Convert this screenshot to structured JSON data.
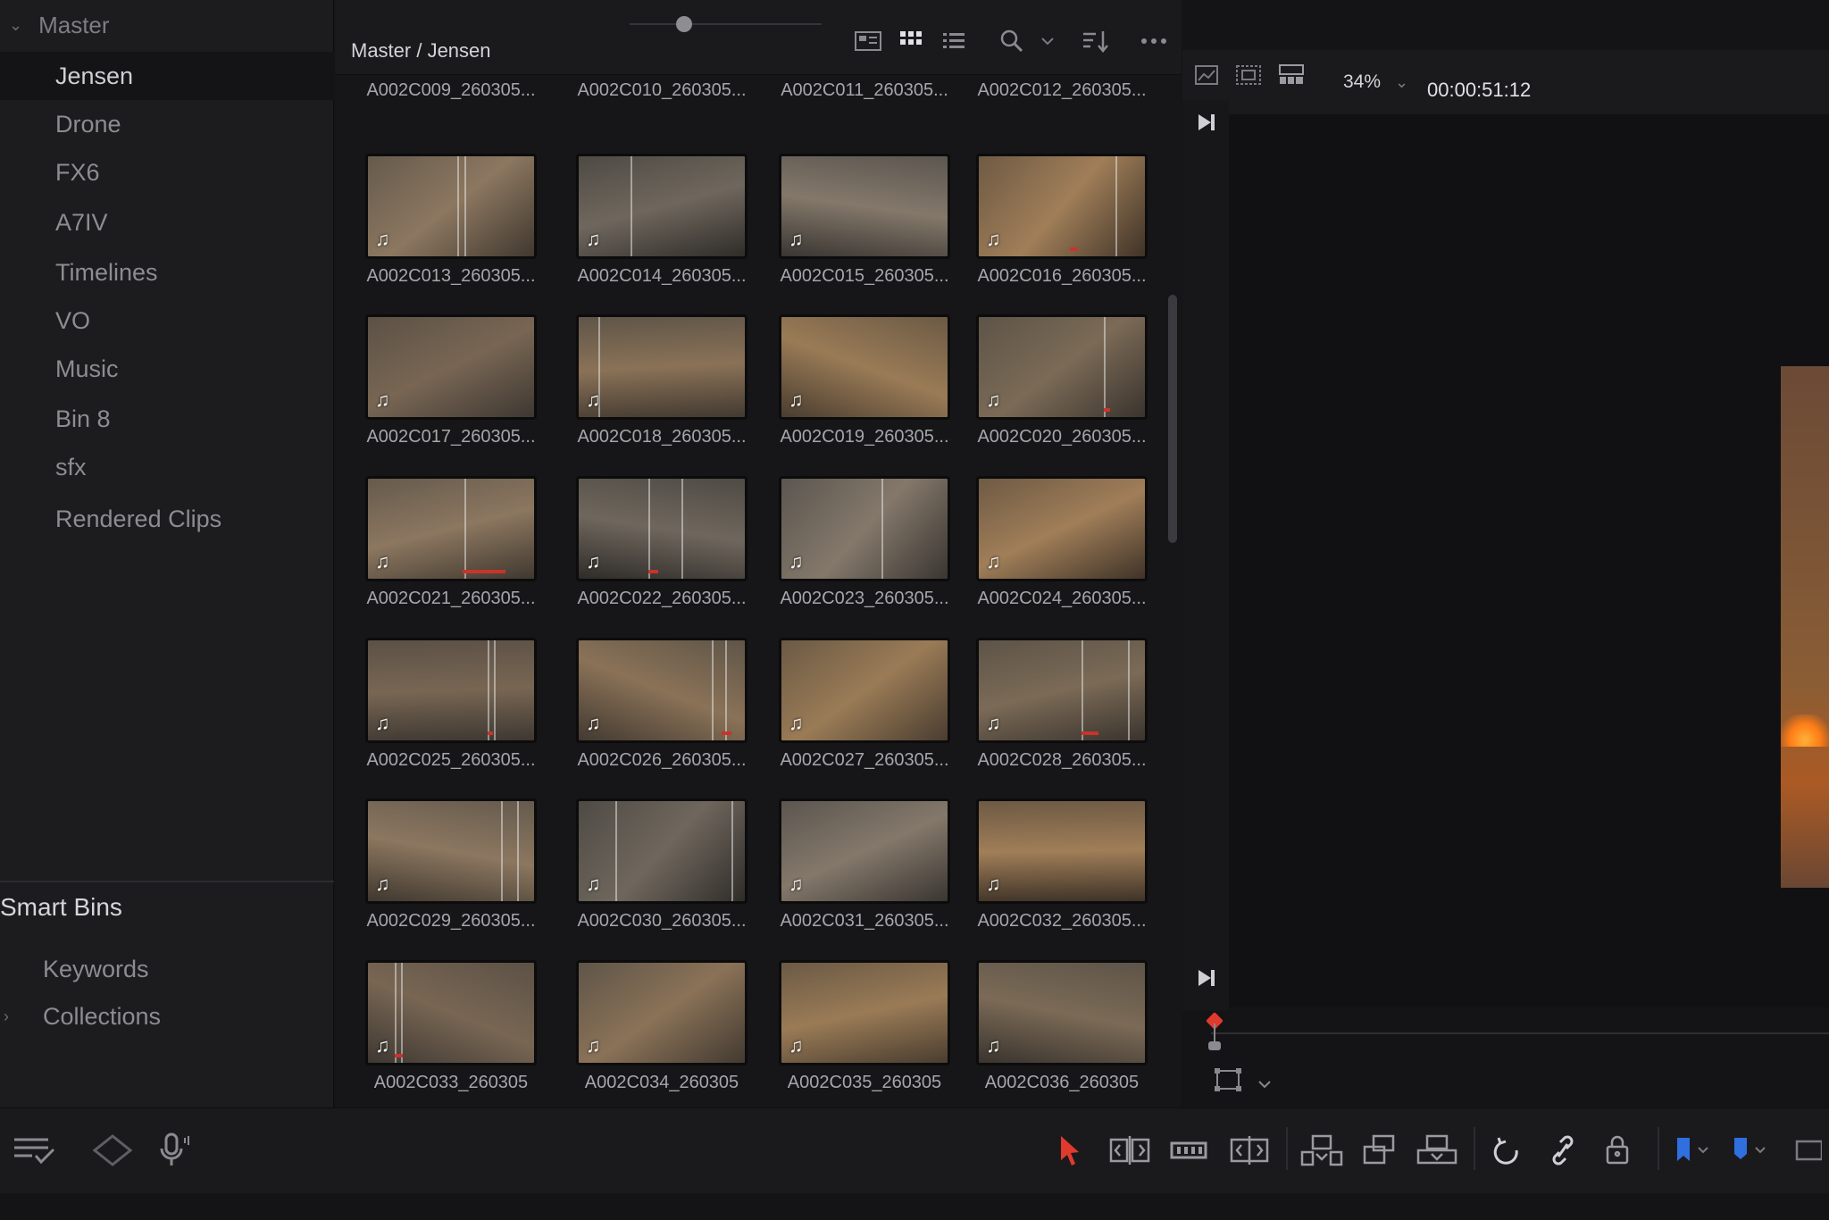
{
  "sidebar": {
    "root_label": "Master",
    "items": [
      {
        "label": "Jensen",
        "active": true
      },
      {
        "label": "Drone"
      },
      {
        "label": "FX6"
      },
      {
        "label": "A7IV"
      },
      {
        "label": "Timelines"
      },
      {
        "label": "VO"
      },
      {
        "label": "Music"
      },
      {
        "label": "Bin 8"
      },
      {
        "label": "sfx"
      },
      {
        "label": "Rendered Clips"
      }
    ],
    "smart_bins_title": "Smart Bins",
    "smart_bins": [
      {
        "label": "Keywords"
      },
      {
        "label": "Collections"
      }
    ]
  },
  "pool": {
    "breadcrumb": "Master / Jensen"
  },
  "clips": [
    {
      "name": "A002C009_260305..."
    },
    {
      "name": "A002C010_260305..."
    },
    {
      "name": "A002C011_260305..."
    },
    {
      "name": "A002C012_260305..."
    },
    {
      "name": "A002C013_260305..."
    },
    {
      "name": "A002C014_260305..."
    },
    {
      "name": "A002C015_260305..."
    },
    {
      "name": "A002C016_260305..."
    },
    {
      "name": "A002C017_260305..."
    },
    {
      "name": "A002C018_260305..."
    },
    {
      "name": "A002C019_260305..."
    },
    {
      "name": "A002C020_260305..."
    },
    {
      "name": "A002C021_260305..."
    },
    {
      "name": "A002C022_260305..."
    },
    {
      "name": "A002C023_260305..."
    },
    {
      "name": "A002C024_260305..."
    },
    {
      "name": "A002C025_260305..."
    },
    {
      "name": "A002C026_260305..."
    },
    {
      "name": "A002C027_260305..."
    },
    {
      "name": "A002C028_260305..."
    },
    {
      "name": "A002C029_260305..."
    },
    {
      "name": "A002C030_260305..."
    },
    {
      "name": "A002C031_260305..."
    },
    {
      "name": "A002C032_260305..."
    },
    {
      "name": "A002C033_260305"
    },
    {
      "name": "A002C034_260305"
    },
    {
      "name": "A002C035_260305"
    },
    {
      "name": "A002C036_260305"
    }
  ],
  "viewer": {
    "zoom": "34%",
    "timecode": "00:00:51:12"
  },
  "colors": {
    "accent_red": "#e03a2f",
    "flag_blue": "#2f6fe0",
    "panel_bg": "#1c1c1f"
  }
}
